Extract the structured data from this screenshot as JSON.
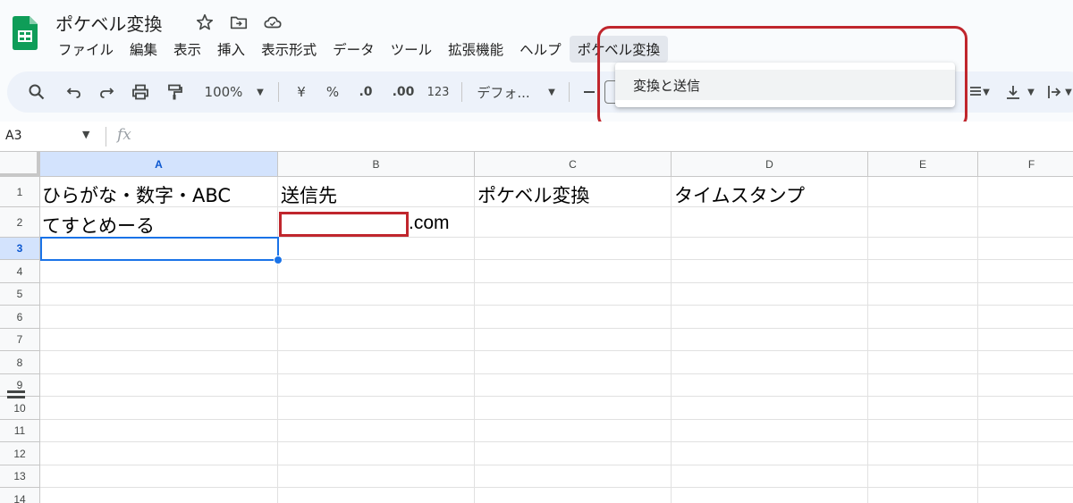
{
  "app": {
    "title": "ポケベル変換"
  },
  "menu": [
    "ファイル",
    "編集",
    "表示",
    "挿入",
    "表示形式",
    "データ",
    "ツール",
    "拡張機能",
    "ヘルプ",
    "ポケベル変換"
  ],
  "dropdown": {
    "item": "変換と送信"
  },
  "toolbar": {
    "zoom": "100%",
    "currency": "¥",
    "percent": "%",
    "decrease_decimal": ".0",
    "increase_decimal": ".00",
    "number_format": "123",
    "font": "デフォ..."
  },
  "formula_bar": {
    "name_box": "A3",
    "fx": "fx"
  },
  "columns": [
    "A",
    "B",
    "C",
    "D",
    "E",
    "F"
  ],
  "rows": [
    "1",
    "2",
    "3",
    "4",
    "5",
    "6",
    "7",
    "8",
    "9",
    "10",
    "11",
    "12",
    "13",
    "14"
  ],
  "cells": {
    "A1": "ひらがな・数字・ABC",
    "B1": "送信先",
    "C1": "ポケベル変換",
    "D1": "タイムスタンプ",
    "A2": "てすとめーる",
    "B2": ".com"
  },
  "colors": {
    "accent": "#1a73e8",
    "highlight": "#c0262d",
    "sheets_green": "#0f9d58"
  },
  "icons": [
    "search-icon",
    "undo-icon",
    "redo-icon",
    "print-icon",
    "paint-format-icon",
    "chevron-down-icon",
    "star-icon",
    "move-folder-icon",
    "cloud-icon",
    "sheets-logo-icon"
  ]
}
